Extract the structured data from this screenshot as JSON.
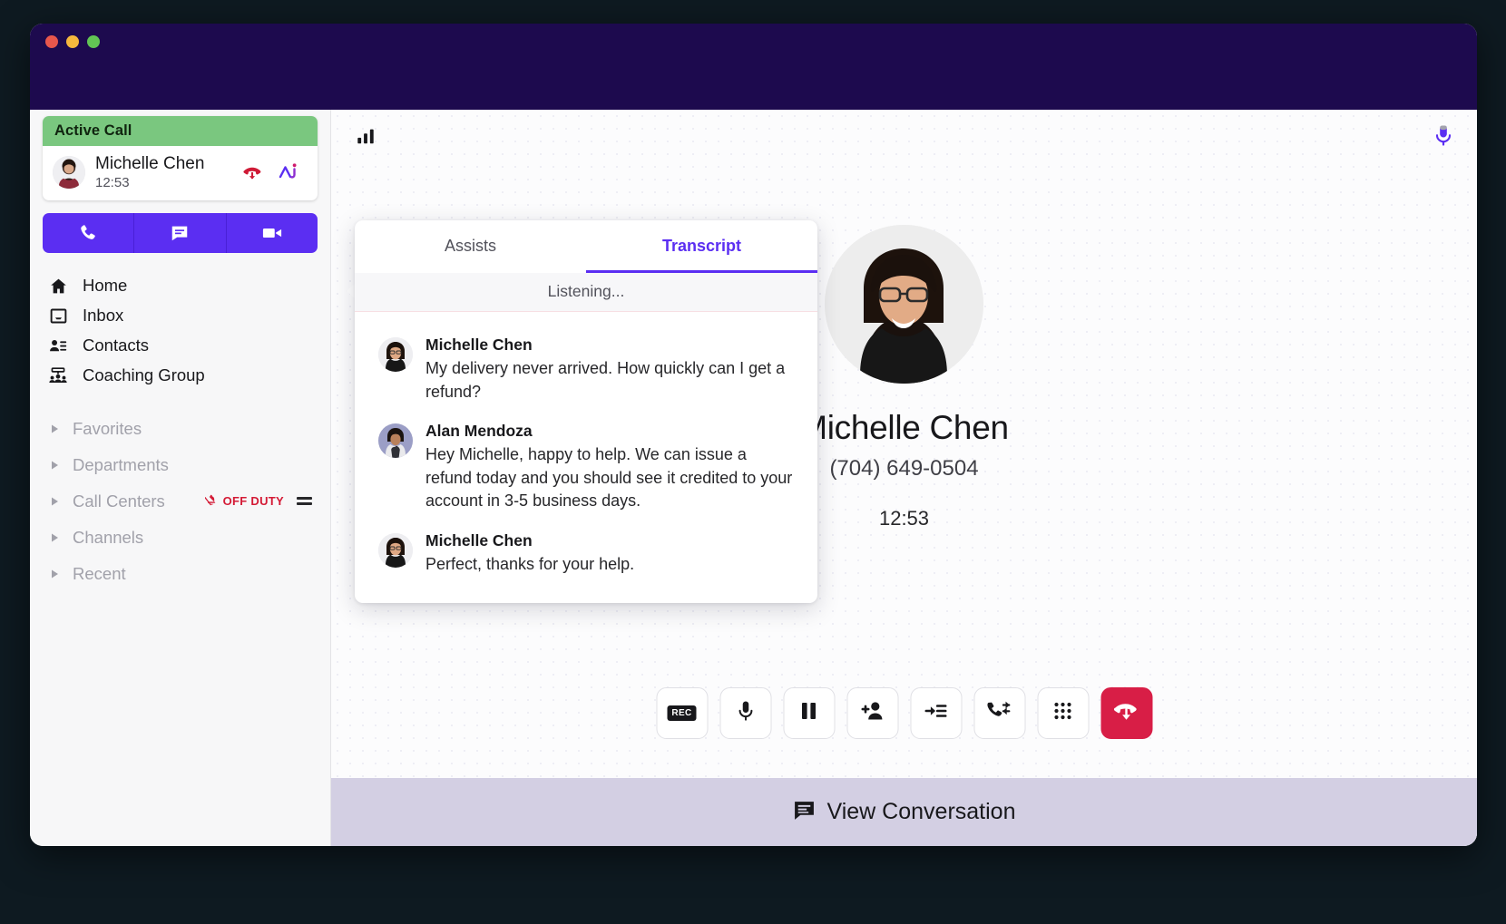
{
  "window": {
    "traffic_lights": [
      "close",
      "minimize",
      "zoom"
    ]
  },
  "sidebar": {
    "active_call": {
      "header_label": "Active Call",
      "contact_name": "Michelle Chen",
      "duration": "12:53",
      "end_call_icon": "hangup-icon",
      "ai_icon": "ai-wave-icon"
    },
    "quick_actions": [
      {
        "name": "phone-icon",
        "label": "Call"
      },
      {
        "name": "message-icon",
        "label": "Message"
      },
      {
        "name": "video-icon",
        "label": "Video"
      }
    ],
    "nav_items": [
      {
        "label": "Home",
        "icon": "home-icon"
      },
      {
        "label": "Inbox",
        "icon": "inbox-icon"
      },
      {
        "label": "Contacts",
        "icon": "contacts-icon"
      },
      {
        "label": "Coaching Group",
        "icon": "coaching-group-icon"
      }
    ],
    "groups": [
      {
        "label": "Favorites",
        "badge": null
      },
      {
        "label": "Departments",
        "badge": null
      },
      {
        "label": "Call Centers",
        "badge": "OFF DUTY",
        "badge_icon": "bell-off-icon",
        "handle": "drag-handle-icon"
      },
      {
        "label": "Channels",
        "badge": null
      },
      {
        "label": "Recent",
        "badge": null
      }
    ],
    "badge_color": "#d41a35"
  },
  "main": {
    "signal_icon": "signal-bars-icon",
    "mic_icon": "microphone-icon",
    "contact_name": "Michelle Chen",
    "contact_phone": "(704) 649-0504",
    "call_timer": "12:53",
    "controls": [
      {
        "name": "record-button",
        "icon": "rec-icon",
        "label": "REC"
      },
      {
        "name": "mute-button",
        "icon": "microphone-icon",
        "label": ""
      },
      {
        "name": "hold-button",
        "icon": "pause-icon",
        "label": ""
      },
      {
        "name": "add-participant-button",
        "icon": "add-person-icon",
        "label": ""
      },
      {
        "name": "move-to-queue-button",
        "icon": "arrow-to-list-icon",
        "label": ""
      },
      {
        "name": "transfer-call-button",
        "icon": "call-transfer-icon",
        "label": ""
      },
      {
        "name": "keypad-button",
        "icon": "dialpad-icon",
        "label": ""
      },
      {
        "name": "end-call-button",
        "icon": "hangup-icon",
        "label": ""
      }
    ],
    "view_conversation": {
      "label": "View Conversation",
      "icon": "chat-bubble-icon",
      "bar_color": "#d3cfe3"
    }
  },
  "transcript": {
    "tabs": [
      {
        "label": "Assists",
        "active": false
      },
      {
        "label": "Transcript",
        "active": true
      }
    ],
    "status": "Listening...",
    "accent_color": "#5b2ef2",
    "messages": [
      {
        "author": "Michelle Chen",
        "text": "My delivery never arrived. How quickly can I get a refund?",
        "avatar": "michelle-avatar"
      },
      {
        "author": "Alan Mendoza",
        "text": "Hey Michelle, happy to help. We can issue a refund today and you should see it credited to your account in 3-5 business days.",
        "avatar": "alan-avatar"
      },
      {
        "author": "Michelle Chen",
        "text": "Perfect, thanks for your help.",
        "avatar": "michelle-avatar"
      }
    ]
  }
}
